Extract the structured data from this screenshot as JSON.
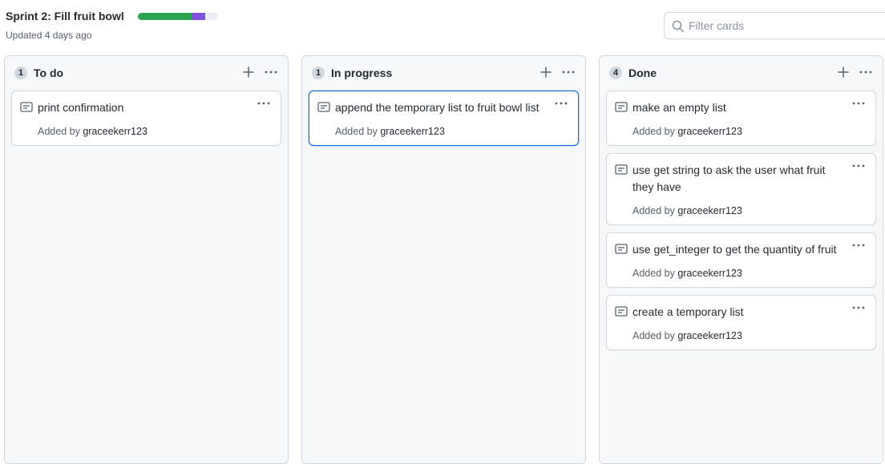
{
  "header": {
    "title": "Sprint 2: Fill fruit bowl",
    "updated": "Updated 4 days ago",
    "progress": {
      "done": 0.67,
      "in_progress": 0.17,
      "done_color": "#2da44e",
      "in_progress_color": "#8250df"
    },
    "filter_placeholder": "Filter cards"
  },
  "columns": [
    {
      "count": "1",
      "title": "To do",
      "cards": [
        {
          "text": "print confirmation",
          "added_prefix": "Added by",
          "user": "graceekerr123"
        }
      ]
    },
    {
      "count": "1",
      "title": "In progress",
      "cards": [
        {
          "text": "append the temporary list to fruit bowl list",
          "added_prefix": "Added by",
          "user": "graceekerr123"
        }
      ]
    },
    {
      "count": "4",
      "title": "Done",
      "cards": [
        {
          "text": "make an empty list",
          "added_prefix": "Added by",
          "user": "graceekerr123"
        },
        {
          "text": "use get string to ask the user what fruit they have",
          "added_prefix": "Added by",
          "user": "graceekerr123"
        },
        {
          "text": "use get_integer to get the quantity of fruit",
          "added_prefix": "Added by",
          "user": "graceekerr123"
        },
        {
          "text": "create a temporary list",
          "added_prefix": "Added by",
          "user": "graceekerr123"
        }
      ]
    }
  ]
}
